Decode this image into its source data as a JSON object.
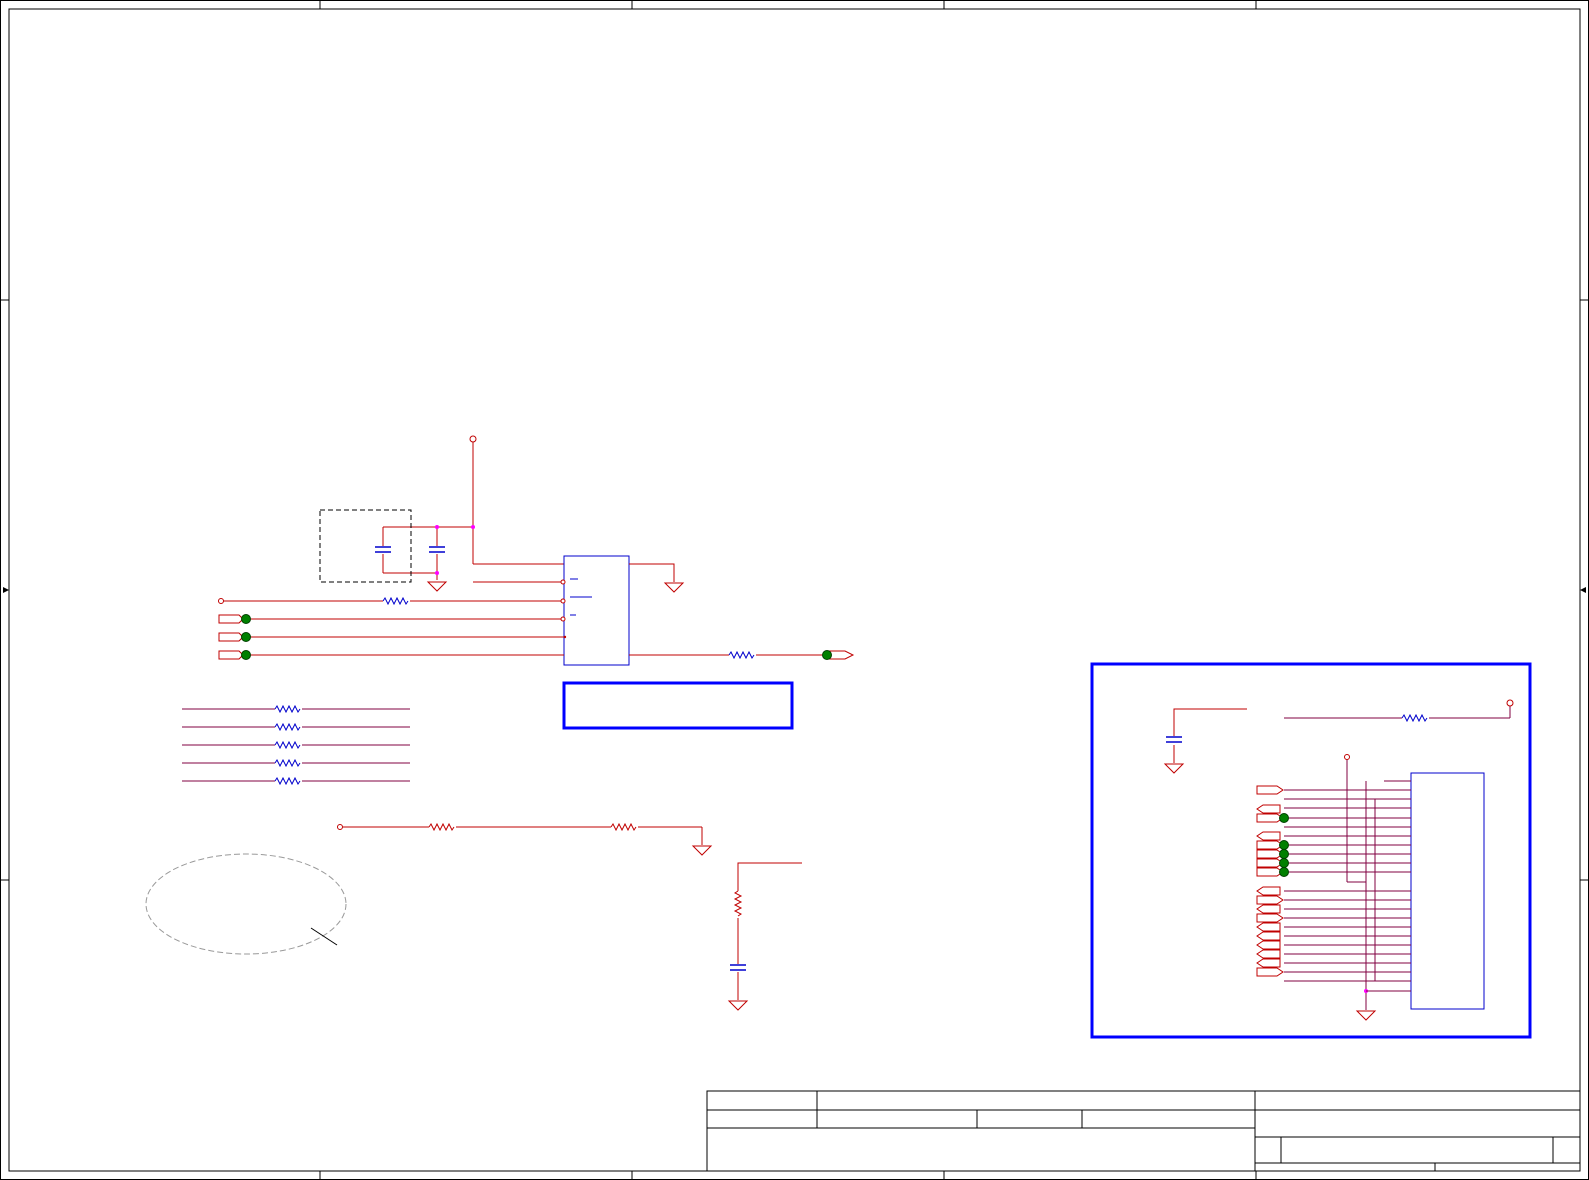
{
  "sheet": {
    "border_color": "#000000",
    "wire_color": "#c00000",
    "net_color": "#800040",
    "component_color": "#0000cc",
    "junction_color": "#ff00ff",
    "port_fill": "#008000",
    "highlight_box_color": "#0000ff",
    "note_ellipse_color": "#999999"
  },
  "title_block": {
    "cells": [
      "",
      "",
      "",
      "",
      "",
      "",
      "",
      "",
      "",
      "",
      "",
      ""
    ]
  }
}
